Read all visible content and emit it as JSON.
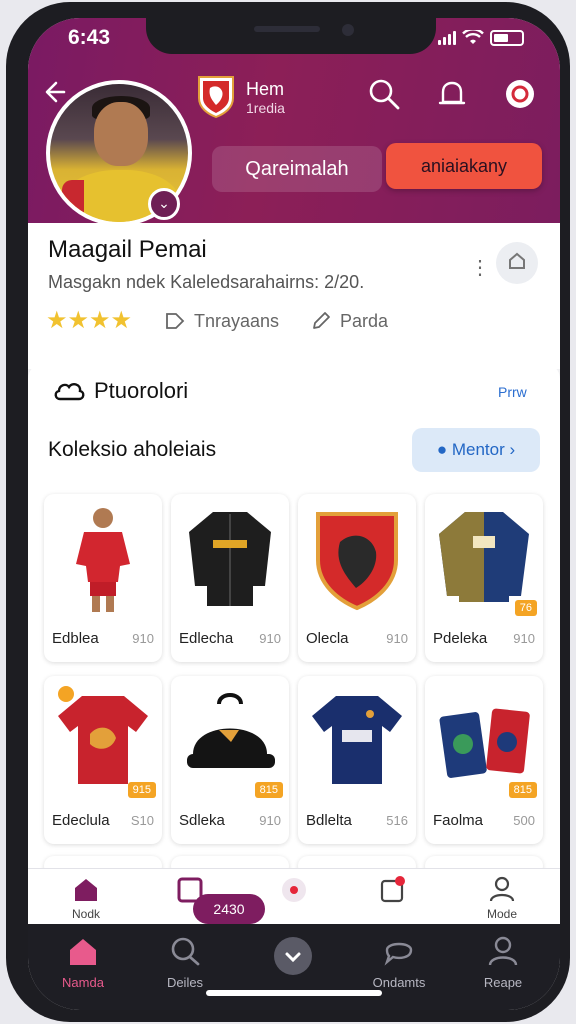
{
  "status_bar": {
    "time": "6:43"
  },
  "header": {
    "club_name": "Hem",
    "club_sub": "1redia",
    "follow_label": "Qareimalah",
    "cta_label": "aniaiakany",
    "notification_counts": [
      "",
      ""
    ]
  },
  "profile": {
    "name": "Maagail Pemai",
    "description": "Masgakn ndek Kaleledsarahairns: 2/20.",
    "stars": "★★★★",
    "action_1": "Tnrayaans",
    "action_2": "Parda"
  },
  "section": {
    "title": "Ptuorolori",
    "link": "Prrw",
    "collection_title": "Koleksio aholeiais",
    "mentor_label": "Mentor"
  },
  "items": [
    {
      "label": "Edblea",
      "price": "910",
      "tag": ""
    },
    {
      "label": "Edlecha",
      "price": "910",
      "tag": ""
    },
    {
      "label": "Olecla",
      "price": "910",
      "tag": ""
    },
    {
      "label": "Pdeleka",
      "price": "910",
      "tag": "76"
    },
    {
      "label": "Edeclula",
      "price": "S10",
      "tag": "915"
    },
    {
      "label": "Sdleka",
      "price": "910",
      "tag": "815"
    },
    {
      "label": "Bdlelta",
      "price": "516",
      "tag": ""
    },
    {
      "label": "Faolma",
      "price": "500",
      "tag": "815"
    }
  ],
  "tab_bar": {
    "items": [
      "Nodk",
      "",
      "",
      "",
      "Mode"
    ],
    "pill_label": "2430"
  },
  "nav_bar": {
    "items": [
      "Namda",
      "Deiles",
      "",
      "Ondamts",
      "Reape"
    ]
  },
  "colors": {
    "header": "#7a1a63",
    "accent": "#f0533f",
    "nav_active": "#e85a8c",
    "link": "#2b6ed0"
  }
}
